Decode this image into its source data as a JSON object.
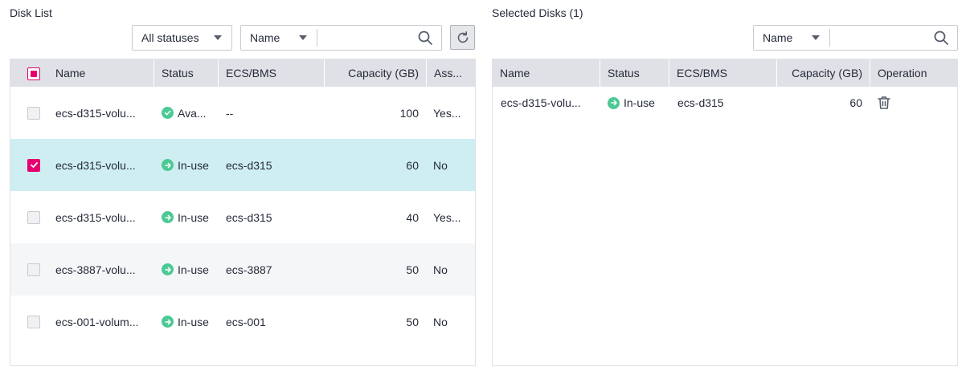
{
  "disk_list": {
    "title": "Disk List",
    "status_filter": "All statuses",
    "search": {
      "field": "Name",
      "value": ""
    },
    "columns": [
      "Name",
      "Status",
      "ECS/BMS",
      "Capacity (GB)",
      "Ass..."
    ],
    "rows": [
      {
        "name": "ecs-d315-volu...",
        "status": "Ava...",
        "ecs": "--",
        "capacity": "100",
        "assoc": "Yes...",
        "checked": false
      },
      {
        "name": "ecs-d315-volu...",
        "status": "In-use",
        "ecs": "ecs-d315",
        "capacity": "60",
        "assoc": "No",
        "checked": true
      },
      {
        "name": "ecs-d315-volu...",
        "status": "In-use",
        "ecs": "ecs-d315",
        "capacity": "40",
        "assoc": "Yes...",
        "checked": false
      },
      {
        "name": "ecs-3887-volu...",
        "status": "In-use",
        "ecs": "ecs-3887",
        "capacity": "50",
        "assoc": "No",
        "checked": false
      },
      {
        "name": "ecs-001-volum...",
        "status": "In-use",
        "ecs": "ecs-001",
        "capacity": "50",
        "assoc": "No",
        "checked": false
      }
    ]
  },
  "selected_disks": {
    "title": "Selected Disks (1)",
    "search": {
      "field": "Name",
      "value": ""
    },
    "columns": [
      "Name",
      "Status",
      "ECS/BMS",
      "Capacity (GB)",
      "Operation"
    ],
    "rows": [
      {
        "name": "ecs-d315-volu...",
        "status": "In-use",
        "ecs": "ecs-d315",
        "capacity": "60"
      }
    ]
  },
  "colors": {
    "accent": "#e6006f",
    "status_ok": "#4cc994",
    "selected_row": "#cfeef2",
    "header_bg": "#dfe1e6"
  }
}
